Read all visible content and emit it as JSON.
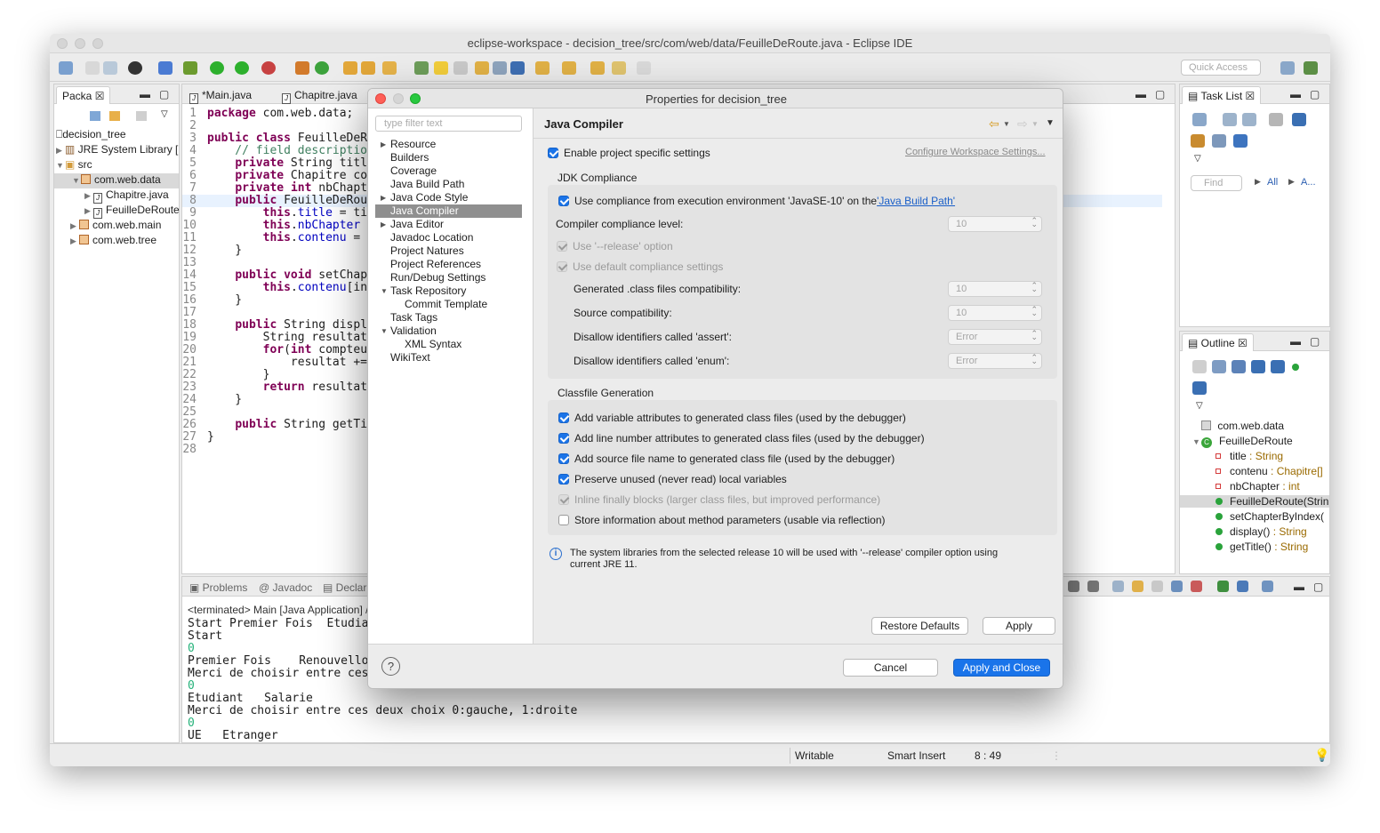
{
  "window": {
    "title": "eclipse-workspace - decision_tree/src/com/web/data/FeuilleDeRoute.java - Eclipse IDE",
    "quick_access_placeholder": "Quick Access"
  },
  "package_explorer": {
    "tab_label": "Packa",
    "project": "decision_tree",
    "items": [
      {
        "label": "JRE System Library ["
      },
      {
        "label": "src"
      },
      {
        "label": "com.web.data"
      },
      {
        "label": "Chapitre.java"
      },
      {
        "label": "FeuilleDeRoute"
      },
      {
        "label": "com.web.main"
      },
      {
        "label": "com.web.tree"
      }
    ]
  },
  "editor": {
    "tabs": [
      "*Main.java",
      "Chapitre.java"
    ],
    "line_numbers": [
      "1",
      "2",
      "3",
      "4",
      "5",
      "6",
      "7",
      "8",
      "9",
      "10",
      "11",
      "12",
      "13",
      "14",
      "15",
      "16",
      "17",
      "18",
      "19",
      "20",
      "21",
      "22",
      "23",
      "24",
      "25",
      "26",
      "27",
      "28"
    ],
    "lines": [
      "package com.web.data;",
      "",
      "public class FeuilleDeR",
      "    // field descriptio",
      "    private String titl",
      "    private Chapitre co",
      "    private int nbChapt",
      "    public FeuilleDeRou",
      "        this.title = ti",
      "        this.nbChapter ",
      "        this.contenu = ",
      "    }",
      "",
      "    public void setChap",
      "        this.contenu[in",
      "    }",
      "",
      "    public String displ",
      "        String resultat",
      "        for(int compteu",
      "            resultat +=",
      "        }",
      "        return resultat",
      "    }",
      "",
      "    public String getTi",
      "}",
      ""
    ]
  },
  "bottom_panel": {
    "tabs": [
      "Problems",
      "Javadoc",
      "Declar"
    ],
    "console_header": "<terminated> Main [Java Application] /",
    "console_lines": [
      "Start Premier Fois  Etudiant",
      "Start",
      "0",
      "Premier Fois    Renouvellomer",
      "Merci de choisir entre ces d",
      "0",
      "Etudiant   Salarie",
      "Merci de choisir entre ces deux choix 0:gauche, 1:droite",
      "0",
      "UE   Etranger"
    ]
  },
  "task_list": {
    "tab_label": "Task List",
    "find_placeholder": "Find",
    "all_label": "All",
    "a_label": "A..."
  },
  "outline": {
    "tab_label": "Outline",
    "package": "com.web.data",
    "class": "FeuilleDeRoute",
    "members": [
      {
        "name": "title",
        "type": " : String",
        "kind": "field"
      },
      {
        "name": "contenu",
        "type": " : Chapitre[]",
        "kind": "field"
      },
      {
        "name": "nbChapter",
        "type": " : int",
        "kind": "field"
      },
      {
        "name": "FeuilleDeRoute(Strin",
        "type": "",
        "kind": "constructor"
      },
      {
        "name": "setChapterByIndex(",
        "type": "",
        "kind": "method"
      },
      {
        "name": "display()",
        "type": " : String",
        "kind": "method"
      },
      {
        "name": "getTitle()",
        "type": " : String",
        "kind": "method"
      }
    ]
  },
  "statusbar": {
    "writable": "Writable",
    "insert_mode": "Smart Insert",
    "position": "8 : 49"
  },
  "dialog": {
    "title": "Properties for decision_tree",
    "filter_placeholder": "type filter text",
    "nav": [
      {
        "label": "Resource"
      },
      {
        "label": "Builders"
      },
      {
        "label": "Coverage"
      },
      {
        "label": "Java Build Path"
      },
      {
        "label": "Java Code Style"
      },
      {
        "label": "Java Compiler"
      },
      {
        "label": "Java Editor"
      },
      {
        "label": "Javadoc Location"
      },
      {
        "label": "Project Natures"
      },
      {
        "label": "Project References"
      },
      {
        "label": "Run/Debug Settings"
      },
      {
        "label": "Task Repository"
      },
      {
        "label": "Commit Template"
      },
      {
        "label": "Task Tags"
      },
      {
        "label": "Validation"
      },
      {
        "label": "XML Syntax"
      },
      {
        "label": "WikiText"
      }
    ],
    "page_title": "Java Compiler",
    "enable_specific": "Enable project specific settings",
    "configure_workspace_link": "Configure Workspace Settings...",
    "jdk_group_title": "JDK Compliance",
    "use_compliance_prefix": "Use compliance from execution environment 'JavaSE-10' on the ",
    "use_compliance_link": "'Java Build Path'",
    "compliance_level_label": "Compiler compliance level:",
    "compliance_level_value": "10",
    "use_release": "Use '--release' option",
    "use_default_compliance": "Use default compliance settings",
    "generated_class_label": "Generated .class files compatibility:",
    "generated_class_value": "10",
    "source_compat_label": "Source compatibility:",
    "source_compat_value": "10",
    "disallow_assert_label": "Disallow identifiers called 'assert':",
    "disallow_assert_value": "Error",
    "disallow_enum_label": "Disallow identifiers called 'enum':",
    "disallow_enum_value": "Error",
    "classfile_group_title": "Classfile Generation",
    "classfile_options": [
      {
        "label": "Add variable attributes to generated class files (used by the debugger)",
        "state": "on"
      },
      {
        "label": "Add line number attributes to generated class files (used by the debugger)",
        "state": "on"
      },
      {
        "label": "Add source file name to generated class file (used by the debugger)",
        "state": "on"
      },
      {
        "label": "Preserve unused (never read) local variables",
        "state": "on"
      },
      {
        "label": "Inline finally blocks (larger class files, but improved performance)",
        "state": "disabled"
      },
      {
        "label": "Store information about method parameters (usable via reflection)",
        "state": "off"
      }
    ],
    "info_line1": "The system libraries from the selected release 10 will be used with '--release' compiler option using",
    "info_line2": "current JRE 11.",
    "restore_defaults": "Restore Defaults",
    "apply": "Apply",
    "cancel": "Cancel",
    "apply_and_close": "Apply and Close"
  }
}
